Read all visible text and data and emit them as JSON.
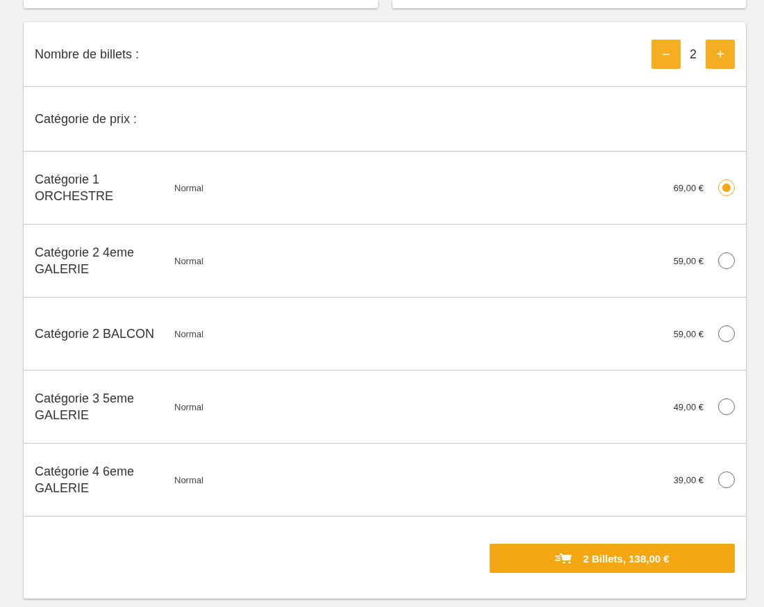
{
  "ticket_count": {
    "label": "Nombre de billets :",
    "value": "2",
    "decrement": "−",
    "increment": "+"
  },
  "price_category": {
    "label": "Catégorie de prix :"
  },
  "categories": [
    {
      "name": "Catégorie 1 ORCHESTRE",
      "rate": "Normal",
      "price": "69,00 €",
      "selected": true
    },
    {
      "name": "Catégorie 2 4eme GALERIE",
      "rate": "Normal",
      "price": "59,00 €",
      "selected": false
    },
    {
      "name": "Catégorie 2 BALCON",
      "rate": "Normal",
      "price": "59,00 €",
      "selected": false
    },
    {
      "name": "Catégorie 3 5eme GALERIE",
      "rate": "Normal",
      "price": "49,00 €",
      "selected": false
    },
    {
      "name": "Catégorie 4 6eme GALERIE",
      "rate": "Normal",
      "price": "39,00 €",
      "selected": false
    }
  ],
  "cart_button": {
    "label": "2 Billets, 138,00 €"
  }
}
